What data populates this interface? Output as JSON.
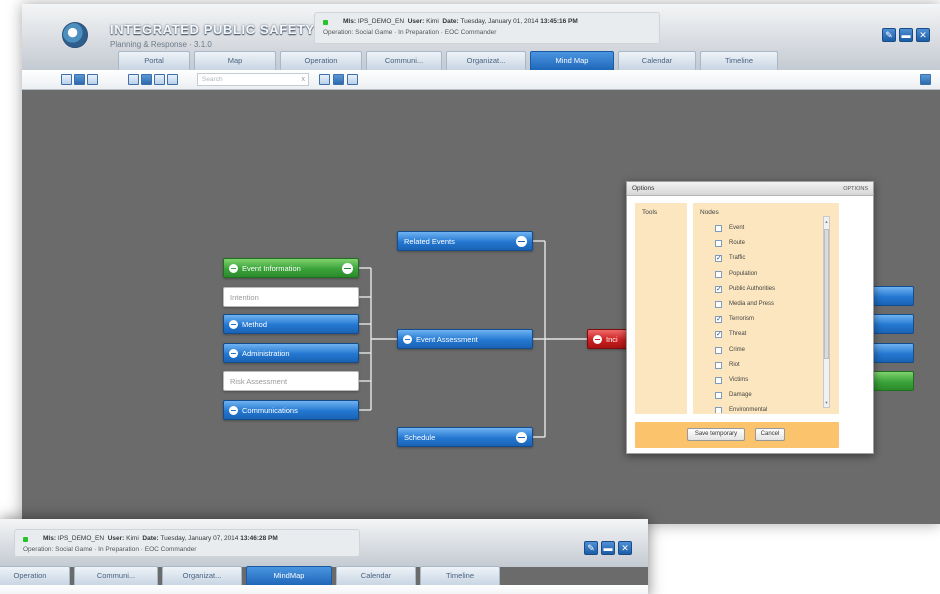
{
  "app": {
    "title": "INTEGRATED PUBLIC SAFETY",
    "subtitle": "Planning & Response · 3.1.0"
  },
  "info": {
    "dot_color": "#27c427",
    "mis_label": "MIs:",
    "mis_value": "IPS_DEMO_EN",
    "user_label": "User:",
    "user_value": "Kimi",
    "date_label": "Date:",
    "date_value": "Tuesday, January 01, 2014",
    "time_value": "13:45:16 PM",
    "operation_line": "Operation: Social Game  ·  In Preparation  ·  EOC Commander"
  },
  "window_buttons": [
    "edit-icon",
    "minimize-icon",
    "close-icon"
  ],
  "tabs": [
    {
      "label": "Portal"
    },
    {
      "label": "Map"
    },
    {
      "label": "Operation"
    },
    {
      "label": "Communi..."
    },
    {
      "label": "Organizat..."
    },
    {
      "label": "Mind Map"
    },
    {
      "label": "Calendar"
    },
    {
      "label": "Timeline"
    }
  ],
  "active_tab": "Mind Map",
  "toolbar": {
    "search_placeholder": "Search",
    "clear_label": "x"
  },
  "mindmap": {
    "left_nodes": [
      {
        "label": "Event Information",
        "color": "green"
      },
      {
        "label": "Intention",
        "color": "white"
      },
      {
        "label": "Method",
        "color": "blue"
      },
      {
        "label": "Administration",
        "color": "blue"
      },
      {
        "label": "Risk Assessment",
        "color": "white"
      },
      {
        "label": "Communications",
        "color": "blue"
      }
    ],
    "middle_nodes": [
      {
        "label": "Related Events"
      },
      {
        "label": "Event Assessment"
      },
      {
        "label": "Schedule"
      }
    ],
    "center_node": {
      "label": "Inci"
    }
  },
  "dialog": {
    "title": "Options",
    "title_right": "OPTIONS",
    "tools_title": "Tools",
    "nodes_title": "Nodes",
    "nodes": [
      {
        "label": "Event",
        "checked": false
      },
      {
        "label": "Route",
        "checked": false
      },
      {
        "label": "Traffic",
        "checked": true
      },
      {
        "label": "Population",
        "checked": false
      },
      {
        "label": "Public Authorities",
        "checked": true
      },
      {
        "label": "Media and Press",
        "checked": false
      },
      {
        "label": "Terrorism",
        "checked": true
      },
      {
        "label": "Threat",
        "checked": true
      },
      {
        "label": "Crime",
        "checked": false
      },
      {
        "label": "Riot",
        "checked": false
      },
      {
        "label": "Victims",
        "checked": false
      },
      {
        "label": "Damage",
        "checked": false
      },
      {
        "label": "Environmental",
        "checked": false
      }
    ],
    "save_label": "Save temporary",
    "cancel_label": "Cancel"
  },
  "second_window": {
    "mis_label": "MIs:",
    "mis_value": "IPS_DEMO_EN",
    "user_label": "User:",
    "user_value": "Kimi",
    "date_label": "Date:",
    "date_value": "Tuesday, January 07, 2014",
    "time_value": "13:46:28 PM",
    "operation_line": "Operation: Social Game  ·  In Preparation  ·  EOC Commander",
    "tabs": [
      {
        "label": "Operation"
      },
      {
        "label": "Communi..."
      },
      {
        "label": "Organizat..."
      },
      {
        "label": "MindMap"
      },
      {
        "label": "Calendar"
      },
      {
        "label": "Timeline"
      }
    ],
    "active_tab": "MindMap"
  }
}
